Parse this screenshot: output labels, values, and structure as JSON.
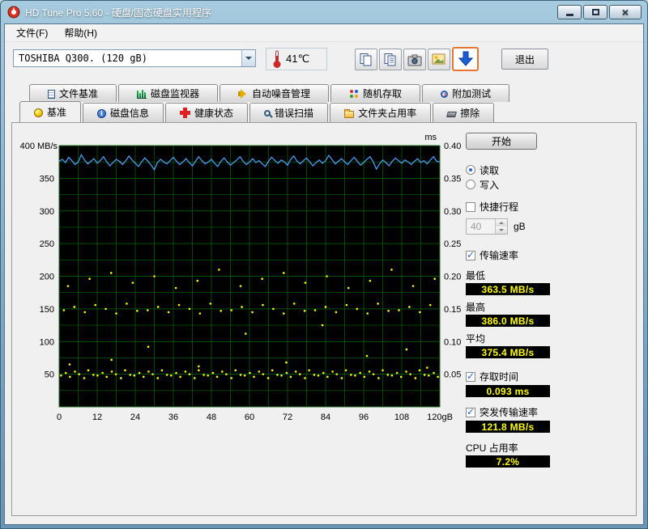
{
  "window": {
    "title": "HD Tune Pro 5.60 - 硬盘/固态硬盘实用程序"
  },
  "menu": {
    "items": [
      {
        "label": "文件(F)"
      },
      {
        "label": "帮助(H)"
      }
    ]
  },
  "toolbar": {
    "drive_select": "TOSHIBA Q300. (120 gB)",
    "temperature": "41℃",
    "exit_label": "退出"
  },
  "tabs": {
    "top": [
      {
        "id": "file-benchmark",
        "label": "文件基准",
        "icon": "file-benchmark-icon"
      },
      {
        "id": "disk-monitor",
        "label": "磁盘监视器",
        "icon": "disk-monitor-icon"
      },
      {
        "id": "aam",
        "label": "自动噪音管理",
        "icon": "aam-icon"
      },
      {
        "id": "random-access",
        "label": "随机存取",
        "icon": "random-access-icon"
      },
      {
        "id": "extra-tests",
        "label": "附加测试",
        "icon": "extra-tests-icon"
      }
    ],
    "bottom": [
      {
        "id": "benchmark",
        "label": "基准",
        "icon": "benchmark-lamp-icon",
        "active": true
      },
      {
        "id": "disk-info",
        "label": "磁盘信息",
        "icon": "disk-info-icon"
      },
      {
        "id": "health",
        "label": "健康状态",
        "icon": "health-icon"
      },
      {
        "id": "error-scan",
        "label": "错误扫描",
        "icon": "error-scan-icon"
      },
      {
        "id": "folder-usage",
        "label": "文件夹占用率",
        "icon": "folder-usage-icon"
      },
      {
        "id": "erase",
        "label": "擦除",
        "icon": "erase-icon"
      }
    ]
  },
  "panel": {
    "start_label": "开始",
    "read_label": "读取",
    "write_label": "写入",
    "shortstroke_label": "快捷行程",
    "shortstroke_value": "40",
    "shortstroke_unit": "gB",
    "transfer_label": "传输速率",
    "min_label": "最低",
    "min_value": "363.5 MB/s",
    "max_label": "最高",
    "max_value": "386.0 MB/s",
    "avg_label": "平均",
    "avg_value": "375.4 MB/s",
    "access_label": "存取时间",
    "access_value": "0.093 ms",
    "burst_label": "突发传输速率",
    "burst_value": "121.8 MB/s",
    "cpu_label": "CPU 占用率",
    "cpu_value": "7.2%"
  },
  "chart_data": {
    "type": "line",
    "title": "",
    "plot_bg": "#000000",
    "grid_color": "#006a00",
    "grid": {
      "x_minor": 6,
      "y_minor": 25
    },
    "x": {
      "label": "gB",
      "min": 0,
      "max": 120,
      "tick_step": 12,
      "tick_labels": [
        "0",
        "12",
        "24",
        "36",
        "48",
        "60",
        "72",
        "84",
        "96",
        "108",
        "120gB"
      ]
    },
    "y_left": {
      "label": "MB/s",
      "min": 0,
      "max": 400,
      "ticks": [
        400,
        350,
        300,
        250,
        200,
        150,
        100,
        50
      ]
    },
    "y_right": {
      "label": "ms",
      "min": 0,
      "max": 0.4,
      "ticks": [
        "0.40",
        "0.35",
        "0.30",
        "0.25",
        "0.20",
        "0.15",
        "0.10",
        "0.05"
      ]
    },
    "series": [
      {
        "name": "transfer_rate_MBps",
        "type": "line",
        "color": "#4da6ff",
        "x_step": 1,
        "values": [
          376,
          379,
          374,
          382,
          377,
          371,
          375,
          386,
          378,
          372,
          376,
          380,
          373,
          377,
          383,
          375,
          369,
          374,
          379,
          376,
          371,
          377,
          384,
          378,
          373,
          368,
          375,
          381,
          376,
          370,
          363,
          374,
          379,
          375,
          372,
          377,
          382,
          376,
          371,
          375,
          380,
          374,
          369,
          376,
          383,
          377,
          372,
          375,
          379,
          373,
          368,
          376,
          381,
          375,
          370,
          374,
          378,
          383,
          376,
          371,
          375,
          380,
          374,
          377,
          372,
          368,
          376,
          382,
          377,
          373,
          378,
          375,
          370,
          379,
          384,
          376,
          372,
          377,
          381,
          375,
          369,
          374,
          378,
          373,
          377,
          385,
          379,
          372,
          376,
          380,
          375,
          371,
          377,
          382,
          376,
          370,
          374,
          379,
          383,
          375,
          364,
          372,
          378,
          374,
          369,
          376,
          381,
          377,
          373,
          378,
          375,
          371,
          376,
          380,
          374,
          377,
          372,
          378,
          383,
          376,
          375
        ]
      },
      {
        "name": "access_time_ms",
        "type": "scatter",
        "color": "#ffff00",
        "points": [
          [
            0.6,
            0.048
          ],
          [
            2.1,
            0.052
          ],
          [
            3.4,
            0.046
          ],
          [
            5.0,
            0.054
          ],
          [
            6.3,
            0.05
          ],
          [
            7.9,
            0.044
          ],
          [
            9.2,
            0.056
          ],
          [
            10.8,
            0.049
          ],
          [
            12.1,
            0.048
          ],
          [
            13.7,
            0.052
          ],
          [
            15.0,
            0.046
          ],
          [
            16.6,
            0.054
          ],
          [
            17.9,
            0.05
          ],
          [
            19.5,
            0.044
          ],
          [
            20.8,
            0.056
          ],
          [
            22.4,
            0.049
          ],
          [
            23.7,
            0.048
          ],
          [
            25.3,
            0.052
          ],
          [
            26.6,
            0.046
          ],
          [
            28.2,
            0.054
          ],
          [
            29.5,
            0.05
          ],
          [
            31.1,
            0.044
          ],
          [
            32.4,
            0.056
          ],
          [
            34.0,
            0.049
          ],
          [
            35.3,
            0.048
          ],
          [
            36.9,
            0.052
          ],
          [
            38.2,
            0.046
          ],
          [
            39.8,
            0.054
          ],
          [
            41.1,
            0.05
          ],
          [
            42.7,
            0.044
          ],
          [
            44.0,
            0.056
          ],
          [
            45.6,
            0.049
          ],
          [
            46.9,
            0.048
          ],
          [
            48.5,
            0.052
          ],
          [
            49.8,
            0.046
          ],
          [
            51.4,
            0.054
          ],
          [
            52.7,
            0.05
          ],
          [
            54.3,
            0.044
          ],
          [
            55.6,
            0.056
          ],
          [
            57.2,
            0.049
          ],
          [
            58.5,
            0.048
          ],
          [
            60.1,
            0.052
          ],
          [
            61.4,
            0.046
          ],
          [
            63.0,
            0.054
          ],
          [
            64.3,
            0.05
          ],
          [
            65.9,
            0.044
          ],
          [
            67.2,
            0.056
          ],
          [
            68.8,
            0.049
          ],
          [
            70.1,
            0.048
          ],
          [
            71.7,
            0.052
          ],
          [
            73.0,
            0.046
          ],
          [
            74.6,
            0.054
          ],
          [
            75.9,
            0.05
          ],
          [
            77.5,
            0.044
          ],
          [
            78.8,
            0.056
          ],
          [
            80.4,
            0.049
          ],
          [
            81.7,
            0.048
          ],
          [
            83.3,
            0.052
          ],
          [
            84.6,
            0.046
          ],
          [
            86.2,
            0.054
          ],
          [
            87.5,
            0.05
          ],
          [
            89.1,
            0.044
          ],
          [
            90.4,
            0.056
          ],
          [
            92.0,
            0.049
          ],
          [
            93.3,
            0.048
          ],
          [
            94.9,
            0.052
          ],
          [
            96.2,
            0.046
          ],
          [
            97.8,
            0.054
          ],
          [
            99.1,
            0.05
          ],
          [
            100.7,
            0.044
          ],
          [
            102.0,
            0.056
          ],
          [
            103.6,
            0.049
          ],
          [
            104.9,
            0.048
          ],
          [
            106.5,
            0.052
          ],
          [
            107.8,
            0.046
          ],
          [
            109.4,
            0.054
          ],
          [
            110.7,
            0.05
          ],
          [
            112.3,
            0.044
          ],
          [
            113.6,
            0.056
          ],
          [
            115.2,
            0.049
          ],
          [
            116.5,
            0.048
          ],
          [
            118.1,
            0.052
          ],
          [
            119.4,
            0.046
          ],
          [
            1.5,
            0.148
          ],
          [
            4.8,
            0.153
          ],
          [
            8.1,
            0.145
          ],
          [
            11.4,
            0.156
          ],
          [
            14.7,
            0.15
          ],
          [
            18.0,
            0.143
          ],
          [
            21.3,
            0.158
          ],
          [
            24.6,
            0.147
          ],
          [
            27.9,
            0.148
          ],
          [
            31.2,
            0.153
          ],
          [
            34.5,
            0.145
          ],
          [
            37.8,
            0.156
          ],
          [
            41.1,
            0.15
          ],
          [
            44.4,
            0.143
          ],
          [
            47.7,
            0.158
          ],
          [
            51.0,
            0.147
          ],
          [
            54.3,
            0.148
          ],
          [
            57.6,
            0.153
          ],
          [
            60.9,
            0.145
          ],
          [
            64.2,
            0.156
          ],
          [
            67.5,
            0.15
          ],
          [
            70.8,
            0.143
          ],
          [
            74.1,
            0.158
          ],
          [
            77.4,
            0.147
          ],
          [
            80.7,
            0.148
          ],
          [
            84.0,
            0.153
          ],
          [
            87.3,
            0.145
          ],
          [
            90.6,
            0.156
          ],
          [
            93.9,
            0.15
          ],
          [
            97.2,
            0.143
          ],
          [
            100.5,
            0.158
          ],
          [
            103.8,
            0.147
          ],
          [
            107.1,
            0.148
          ],
          [
            110.4,
            0.153
          ],
          [
            113.7,
            0.145
          ],
          [
            117.0,
            0.156
          ],
          [
            2.8,
            0.185
          ],
          [
            9.6,
            0.196
          ],
          [
            16.4,
            0.205
          ],
          [
            23.2,
            0.19
          ],
          [
            30.0,
            0.2
          ],
          [
            36.8,
            0.182
          ],
          [
            43.6,
            0.193
          ],
          [
            50.4,
            0.21
          ],
          [
            57.2,
            0.185
          ],
          [
            64.0,
            0.196
          ],
          [
            70.8,
            0.205
          ],
          [
            77.6,
            0.19
          ],
          [
            84.4,
            0.2
          ],
          [
            91.2,
            0.182
          ],
          [
            98.0,
            0.193
          ],
          [
            104.8,
            0.21
          ],
          [
            111.6,
            0.185
          ],
          [
            118.4,
            0.196
          ],
          [
            3.3,
            0.065
          ],
          [
            16.5,
            0.072
          ],
          [
            28.1,
            0.092
          ],
          [
            44.0,
            0.062
          ],
          [
            58.8,
            0.112
          ],
          [
            71.6,
            0.068
          ],
          [
            83.0,
            0.125
          ],
          [
            97.0,
            0.078
          ],
          [
            109.5,
            0.088
          ],
          [
            116.0,
            0.06
          ]
        ]
      }
    ]
  }
}
